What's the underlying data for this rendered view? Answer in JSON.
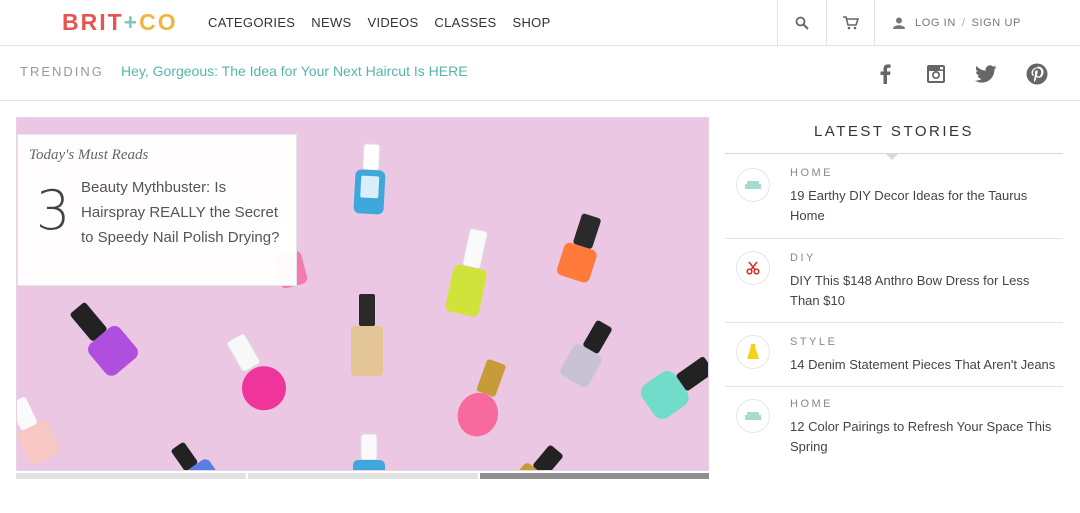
{
  "header": {
    "logo": {
      "left": "BRIT",
      "plus": "+",
      "right": "CO"
    },
    "nav": [
      "CATEGORIES",
      "NEWS",
      "VIDEOS",
      "CLASSES",
      "SHOP"
    ],
    "search_icon": "search-icon",
    "cart_icon": "cart-icon",
    "login_label": "LOG IN",
    "separator": "/",
    "signup_label": "SIGN UP"
  },
  "trending": {
    "label": "TRENDING",
    "link": "Hey, Gorgeous: The Idea for Your Next Haircut Is HERE",
    "social": [
      "facebook-icon",
      "instagram-icon",
      "twitter-icon",
      "pinterest-icon"
    ]
  },
  "hero": {
    "kicker": "Today's Must Reads",
    "number": "3",
    "headline": "Beauty Mythbuster: Is Hairspray REALLY the Secret to Speedy Nail Polish Drying?",
    "slide_current": 3,
    "slide_total": 3
  },
  "sidebar": {
    "title": "LATEST STORIES",
    "stories": [
      {
        "category": "HOME",
        "title": "19 Earthy DIY Decor Ideas for the Taurus Home",
        "icon": "sofa-icon"
      },
      {
        "category": "DIY",
        "title": "DIY This $148 Anthro Bow Dress for Less Than $10",
        "icon": "scissors-icon"
      },
      {
        "category": "STYLE",
        "title": "14 Denim Statement Pieces That Aren't Jeans",
        "icon": "dress-icon"
      },
      {
        "category": "HOME",
        "title": "12 Color Pairings to Refresh Your Space This Spring",
        "icon": "sofa-icon"
      }
    ]
  },
  "colors": {
    "logo_red": "#e6554f",
    "logo_teal": "#7fc7c0",
    "logo_yellow": "#f2b53c",
    "trending_link": "#52b8a8",
    "hero_bg": "#ecc7e4"
  }
}
